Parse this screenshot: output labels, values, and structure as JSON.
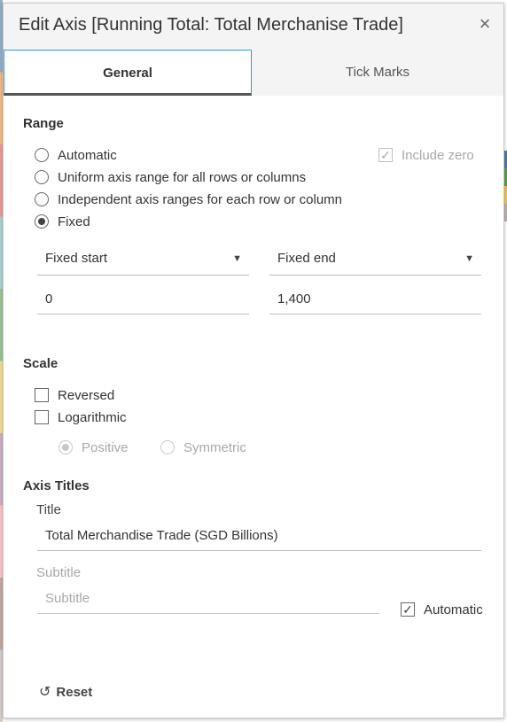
{
  "dialog": {
    "title": "Edit Axis [Running Total: Total Merchanise Trade]",
    "close_icon": "close-icon"
  },
  "tabs": [
    {
      "label": "General",
      "active": true
    },
    {
      "label": "Tick Marks",
      "active": false
    }
  ],
  "range": {
    "heading": "Range",
    "options": [
      {
        "label": "Automatic",
        "selected": false
      },
      {
        "label": "Uniform axis range for all rows or columns",
        "selected": false
      },
      {
        "label": "Independent axis ranges for each row or column",
        "selected": false
      },
      {
        "label": "Fixed",
        "selected": true
      }
    ],
    "include_zero": {
      "label": "Include zero",
      "checked": true,
      "disabled": true
    },
    "start_dropdown": "Fixed start",
    "end_dropdown": "Fixed end",
    "start_value": "0",
    "end_value": "1,400"
  },
  "scale": {
    "heading": "Scale",
    "reversed": {
      "label": "Reversed",
      "checked": false
    },
    "logarithmic": {
      "label": "Logarithmic",
      "checked": false
    },
    "positive": {
      "label": "Positive",
      "selected": true,
      "disabled": true
    },
    "symmetric": {
      "label": "Symmetric",
      "selected": false,
      "disabled": true
    }
  },
  "axis_titles": {
    "heading": "Axis Titles",
    "title_label": "Title",
    "title_value": "Total Merchandise Trade (SGD Billions)",
    "subtitle_label": "Subtitle",
    "subtitle_placeholder": "Subtitle",
    "automatic": {
      "label": "Automatic",
      "checked": true
    }
  },
  "footer": {
    "reset_label": "Reset",
    "reset_icon": "undo-icon"
  },
  "colors": {
    "accent_tab_border": "#2f9ad8",
    "header_bg": "#f4f4f4"
  }
}
